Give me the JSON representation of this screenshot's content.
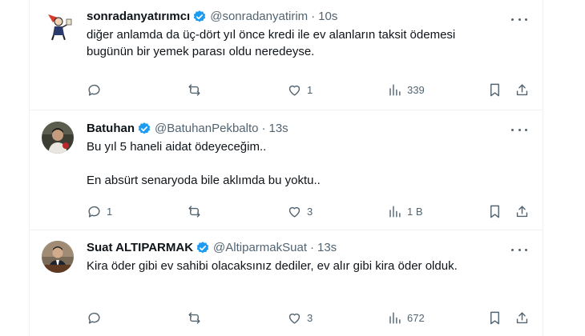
{
  "colors": {
    "text": "#0f1419",
    "muted": "#536471",
    "verified": "#1d9bf0",
    "border": "#eff3f4"
  },
  "tweets": [
    {
      "name": "sonradanyatırımcı",
      "handle": "@sonradanyatirim",
      "separator": "·",
      "time": "10s",
      "lines": [
        "diğer anlamda da üç-dört yıl önce kredi ile ev alanların taksit ödemesi",
        "bugünün bir yemek parası oldu neredeyse."
      ],
      "reply_count": "",
      "retweet_count": "",
      "like_count": "1",
      "view_count": "339"
    },
    {
      "name": "Batuhan",
      "handle": "@BatuhanPekbalto",
      "separator": "·",
      "time": "13s",
      "lines": [
        "Bu yıl 5 haneli aidat ödeyeceğim..",
        "",
        "En absürt senaryoda bile aklımda bu yoktu.."
      ],
      "reply_count": "1",
      "retweet_count": "",
      "like_count": "3",
      "view_count": "1 B"
    },
    {
      "name": "Suat ALTIPARMAK",
      "handle": "@AltiparmakSuat",
      "separator": "·",
      "time": "13s",
      "lines": [
        "Kira öder gibi ev sahibi olacaksınız dediler, ev alır gibi kira öder olduk."
      ],
      "reply_count": "",
      "retweet_count": "",
      "like_count": "3",
      "view_count": "672"
    }
  ]
}
